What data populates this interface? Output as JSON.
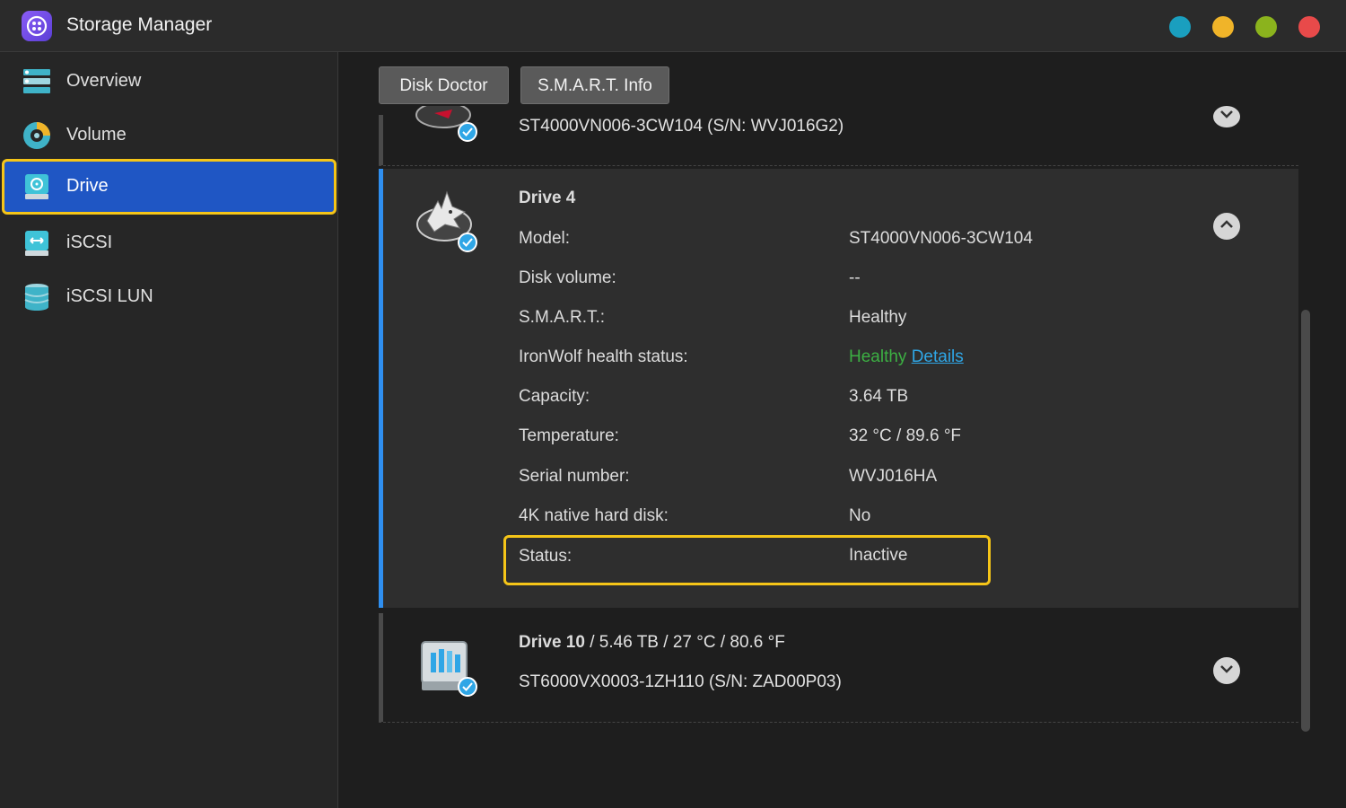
{
  "app": {
    "title": "Storage Manager"
  },
  "window_controls": [
    {
      "name": "window-dot-teal",
      "color": "#1a9fbf"
    },
    {
      "name": "window-dot-yellow",
      "color": "#f0b429"
    },
    {
      "name": "window-dot-green",
      "color": "#8bb31d"
    },
    {
      "name": "window-dot-red",
      "color": "#e84a4a"
    }
  ],
  "sidebar": {
    "items": [
      {
        "label": "Overview",
        "icon": "overview-icon"
      },
      {
        "label": "Volume",
        "icon": "volume-icon"
      },
      {
        "label": "Drive",
        "icon": "drive-icon",
        "active": true
      },
      {
        "label": "iSCSI",
        "icon": "iscsi-icon"
      },
      {
        "label": "iSCSI LUN",
        "icon": "iscsi-lun-icon"
      }
    ]
  },
  "toolbar": {
    "disk_doctor": "Disk Doctor",
    "smart_info": "S.M.A.R.T. Info"
  },
  "drives": {
    "prev": {
      "model_line": "ST4000VN006-3CW104 (S/N: WVJ016G2)"
    },
    "drive4": {
      "title": "Drive 4",
      "rows": [
        {
          "label": "Model:",
          "value": "ST4000VN006-3CW104"
        },
        {
          "label": "Disk volume:",
          "value": "--"
        },
        {
          "label": "S.M.A.R.T.:",
          "value": "Healthy"
        },
        {
          "label": "IronWolf health status:",
          "value": "Healthy",
          "link": "Details"
        },
        {
          "label": "Capacity:",
          "value": "3.64 TB"
        },
        {
          "label": "Temperature:",
          "value": "32 °C / 89.6 °F"
        },
        {
          "label": "Serial number:",
          "value": "WVJ016HA"
        },
        {
          "label": "4K native hard disk:",
          "value": "No"
        },
        {
          "label": "Status:",
          "value": "Inactive"
        }
      ]
    },
    "drive10": {
      "title": "Drive 10",
      "summary": " / 5.46 TB / 27 °C / 80.6 °F",
      "model_line": "ST6000VX0003-1ZH110 (S/N: ZAD00P03)"
    }
  },
  "colors": {
    "accent": "#1f56c4",
    "highlight": "#f5c518",
    "healthy": "#3cb043",
    "link": "#2fa6e6"
  }
}
